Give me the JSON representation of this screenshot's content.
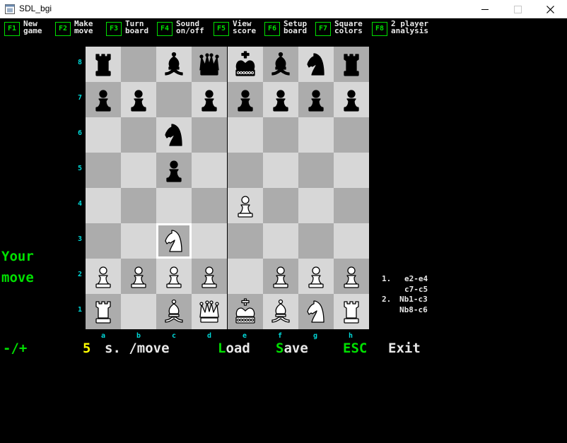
{
  "window": {
    "title": "SDL_bgi"
  },
  "fkeys": [
    {
      "key": "F1",
      "line1": "New",
      "line2": "game"
    },
    {
      "key": "F2",
      "line1": "Make",
      "line2": "move"
    },
    {
      "key": "F3",
      "line1": "Turn",
      "line2": "board"
    },
    {
      "key": "F4",
      "line1": "Sound",
      "line2": "on/off"
    },
    {
      "key": "F5",
      "line1": "View",
      "line2": "score"
    },
    {
      "key": "F6",
      "line1": "Setup",
      "line2": "board"
    },
    {
      "key": "F7",
      "line1": "Square",
      "line2": "colors"
    },
    {
      "key": "F8",
      "line1": "2 player",
      "line2": "analysis"
    }
  ],
  "board": {
    "ranks": [
      "8",
      "7",
      "6",
      "5",
      "4",
      "3",
      "2",
      "1"
    ],
    "files": [
      "a",
      "b",
      "c",
      "d",
      "e",
      "f",
      "g",
      "h"
    ],
    "position": [
      [
        "bR",
        "",
        "bB",
        "bQ",
        "bK",
        "bB",
        "bN",
        "bR"
      ],
      [
        "bP",
        "bP",
        "",
        "bP",
        "bP",
        "bP",
        "bP",
        "bP"
      ],
      [
        "",
        "",
        "bN",
        "",
        "",
        "",
        "",
        ""
      ],
      [
        "",
        "",
        "bP",
        "",
        "",
        "",
        "",
        ""
      ],
      [
        "",
        "",
        "",
        "",
        "wP",
        "",
        "",
        ""
      ],
      [
        "",
        "",
        "wN",
        "",
        "",
        "",
        "",
        ""
      ],
      [
        "wP",
        "wP",
        "wP",
        "wP",
        "",
        "wP",
        "wP",
        "wP"
      ],
      [
        "wR",
        "",
        "wB",
        "wQ",
        "wK",
        "wB",
        "wN",
        "wR"
      ]
    ],
    "selected_square": "c3",
    "light_color": "#d7d7d7",
    "dark_color": "#acacac"
  },
  "status": {
    "line1": "Your",
    "line2": "move"
  },
  "moves": [
    {
      "num": "1.",
      "white": "e2-e4",
      "black": "c7-c5"
    },
    {
      "num": "2.",
      "white": "Nb1-c3",
      "black": "Nb8-c6"
    }
  ],
  "bottom_bar": {
    "adjust": "-/+",
    "seconds": "5",
    "per_move": "s. /move",
    "load_hot": "L",
    "load_rest": "oad",
    "save_hot": "S",
    "save_rest": "ave",
    "esc": "ESC",
    "exit": "Exit"
  },
  "colors": {
    "accent_green": "#00e000",
    "label_cyan": "#00d8d8",
    "highlight_yellow": "#ffff00"
  }
}
